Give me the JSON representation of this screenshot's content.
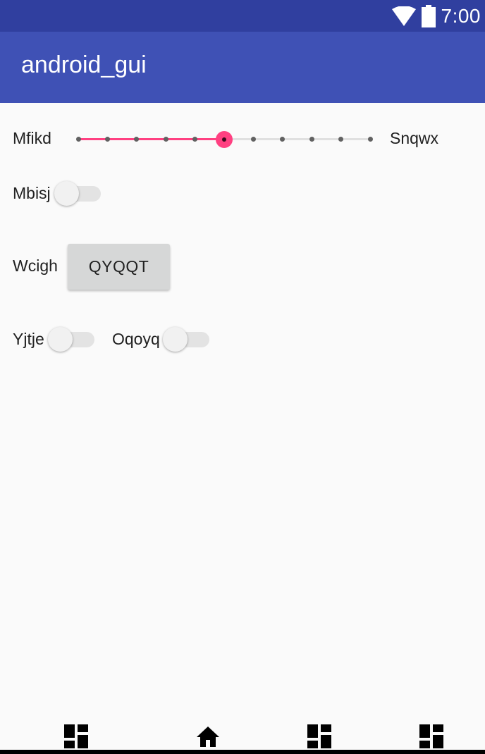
{
  "status_bar": {
    "time": "7:00",
    "icons": [
      "wifi-icon",
      "battery-icon"
    ],
    "bg_color": "#303f9f"
  },
  "app_bar": {
    "title": "android_gui",
    "bg_color": "#3f51b5"
  },
  "seekbar": {
    "left_label": "Mfikd",
    "right_label": "Snqwx",
    "steps": 10,
    "value": 5,
    "accent_color": "#ff4081"
  },
  "switch_row_1": {
    "label": "Mbisj",
    "checked": false
  },
  "button_row": {
    "label": "Wcigh",
    "button_text": "QYQQT"
  },
  "switch_row_2": {
    "left": {
      "label": "Yjtje",
      "checked": false
    },
    "right": {
      "label": "Oqoyq",
      "checked": false
    }
  },
  "bottom_nav": {
    "icons": [
      "dashboard-icon",
      "home-icon",
      "dashboard-icon",
      "dashboard-icon"
    ]
  }
}
